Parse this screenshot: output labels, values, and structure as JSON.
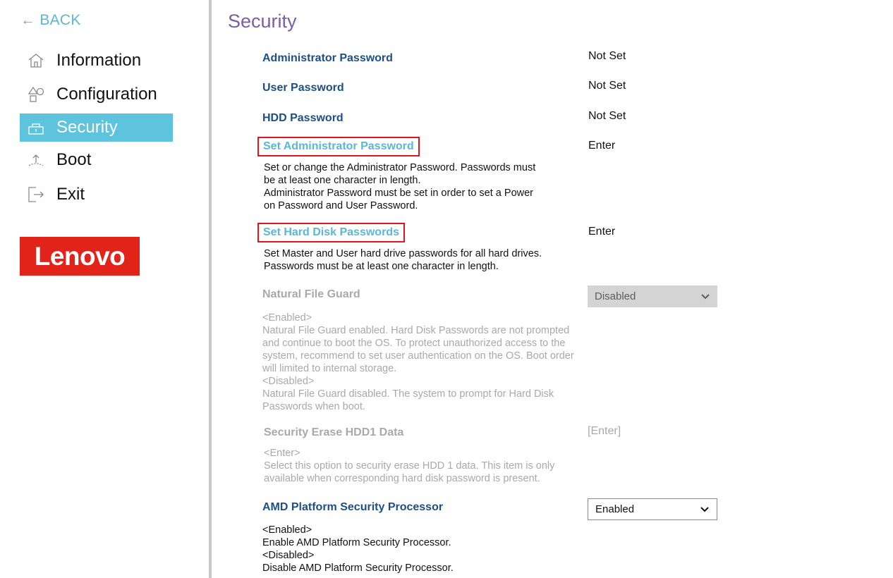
{
  "sidebar": {
    "back_label": "BACK",
    "items": [
      {
        "label": "Information",
        "icon": "home-icon"
      },
      {
        "label": "Configuration",
        "icon": "shapes-icon"
      },
      {
        "label": "Security",
        "icon": "lock-icon",
        "active": true
      },
      {
        "label": "Boot",
        "icon": "boot-icon"
      },
      {
        "label": "Exit",
        "icon": "exit-icon"
      }
    ],
    "logo_text": "Lenovo"
  },
  "main": {
    "title": "Security",
    "settings": [
      {
        "label": "Administrator Password",
        "value": "Not Set"
      },
      {
        "label": "User Password",
        "value": "Not Set"
      },
      {
        "label": "HDD Password",
        "value": "Not Set"
      }
    ],
    "set_admin": {
      "label": "Set Administrator Password",
      "value": "Enter",
      "desc": [
        "Set or change the Administrator Password. Passwords must",
        "be at least one character in length.",
        "Administrator Password must be set in order to set a Power",
        "on Password and User Password."
      ]
    },
    "set_hdd": {
      "label": "Set Hard Disk Passwords",
      "value": "Enter",
      "desc": [
        "Set Master and User hard drive passwords for all hard drives.",
        "Passwords must be at least one character in length."
      ]
    },
    "natural_file_guard": {
      "label": "Natural File Guard",
      "selected": "Disabled",
      "desc": [
        "<Enabled>",
        "Natural File Guard enabled. Hard Disk Passwords are not prompted",
        "and continue to boot the OS. To protect unauthorized access to the",
        "system, recommend to set user authentication on the OS. Boot order",
        "will limited to internal storage.",
        "<Disabled>",
        "Natural File Guard disabled. The system to prompt for Hard Disk",
        "Passwords when boot."
      ]
    },
    "security_erase": {
      "label": "Security Erase HDD1 Data",
      "value": "[Enter]",
      "desc": [
        "<Enter>",
        "Select this option to security erase HDD 1 data. This item is only",
        "available when corresponding hard disk password is present."
      ]
    },
    "amd_psp": {
      "label": "AMD Platform Security Processor",
      "selected": "Enabled",
      "desc": [
        "<Enabled>",
        "Enable AMD Platform Security Processor.",
        "<Disabled>",
        "Disable AMD Platform Security Processor."
      ]
    }
  },
  "colors": {
    "accent": "#5ec3dc",
    "title": "#7a5ea8",
    "label": "#1d4f86",
    "highlight_border": "#e3141e",
    "logo_bg": "#e2231a",
    "disabled_text": "#a9a9a9"
  }
}
